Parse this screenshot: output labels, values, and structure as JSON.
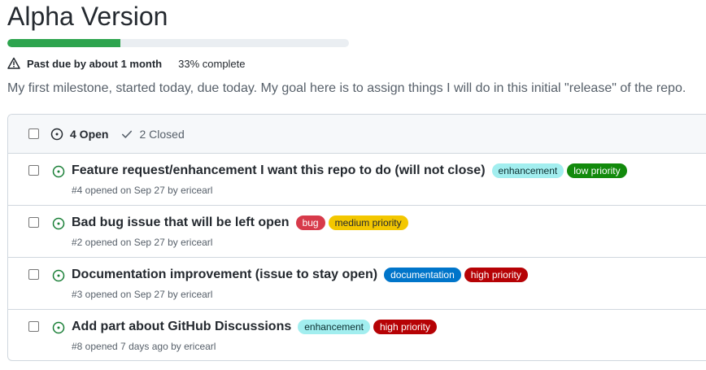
{
  "milestone": {
    "title": "Alpha Version",
    "progress_percent": 33,
    "due_text": "Past due by about 1 month",
    "complete_text": "33% complete",
    "description": "My first milestone, started today, due today. My goal here is to assign things I will do in this initial \"release\" of the repo."
  },
  "colors": {
    "progress": "#2da44e",
    "open_icon": "#1a7f37"
  },
  "header": {
    "open_label": "4 Open",
    "closed_label": "2 Closed"
  },
  "issues": [
    {
      "title": "Feature request/enhancement I want this repo to do (will not close)",
      "subtitle": "#4 opened on Sep 27 by ericearl",
      "labels": [
        {
          "name": "enhancement",
          "bg": "#a2eeef",
          "fg": "#0b2e30"
        },
        {
          "name": "low priority",
          "bg": "#128a0c",
          "fg": "#ffffff"
        }
      ]
    },
    {
      "title": "Bad bug issue that will be left open",
      "subtitle": "#2 opened on Sep 27 by ericearl",
      "labels": [
        {
          "name": "bug",
          "bg": "#d73a4a",
          "fg": "#ffffff"
        },
        {
          "name": "medium priority",
          "bg": "#f3c700",
          "fg": "#24292f"
        }
      ]
    },
    {
      "title": "Documentation improvement (issue to stay open)",
      "subtitle": "#3 opened on Sep 27 by ericearl",
      "labels": [
        {
          "name": "documentation",
          "bg": "#0075ca",
          "fg": "#ffffff"
        },
        {
          "name": "high priority",
          "bg": "#b60205",
          "fg": "#ffffff"
        }
      ]
    },
    {
      "title": "Add part about GitHub Discussions",
      "subtitle": "#8 opened 7 days ago by ericearl",
      "labels": [
        {
          "name": "enhancement",
          "bg": "#a2eeef",
          "fg": "#0b2e30"
        },
        {
          "name": "high priority",
          "bg": "#b60205",
          "fg": "#ffffff"
        }
      ]
    }
  ]
}
